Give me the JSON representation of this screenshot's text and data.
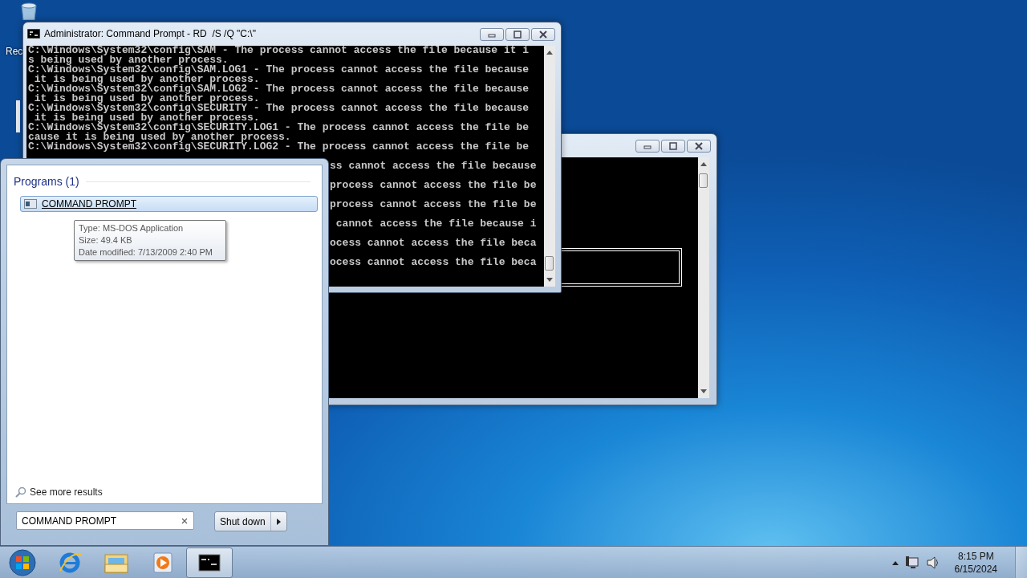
{
  "desktop": {
    "icons": [
      {
        "kind": "recycle_bin",
        "label": "Rec"
      }
    ]
  },
  "console_windows": [
    {
      "title": "Administrator: Command Prompt - RD  /S /Q \"C:\\\"",
      "lines": [
        "C:\\Windows\\System32\\config\\SAM - The process cannot access the file because it i",
        "s being used by another process.",
        "C:\\Windows\\System32\\config\\SAM.LOG1 - The process cannot access the file because",
        " it is being used by another process.",
        "C:\\Windows\\System32\\config\\SAM.LOG2 - The process cannot access the file because",
        " it is being used by another process.",
        "C:\\Windows\\System32\\config\\SECURITY - The process cannot access the file because",
        " it is being used by another process.",
        "C:\\Windows\\System32\\config\\SECURITY.LOG1 - The process cannot access the file be",
        "cause it is being used by another process.",
        "C:\\Windows\\System32\\config\\SECURITY.LOG2 - The process cannot access the file be"
      ],
      "partial_lines": [
        "ss cannot access the file because",
        "process cannot access the file be",
        "process cannot access the file be",
        " cannot access the file because i",
        "ocess cannot access the file beca",
        "ocess cannot access the file beca"
      ]
    },
    {
      "kind": "outlined_box"
    }
  ],
  "start_menu": {
    "section_title": "Programs (1)",
    "results": [
      {
        "label": "COMMAND PROMPT",
        "selected": true
      }
    ],
    "tooltip": [
      "Type: MS-DOS Application",
      "Size: 49.4 KB",
      "Date modified: 7/13/2009 2:40 PM"
    ],
    "see_more": "See more results",
    "search": {
      "value": "COMMAND PROMPT"
    },
    "shutdown": "Shut down"
  },
  "taskbar": {
    "apps": [
      {
        "kind": "ie",
        "active": false
      },
      {
        "kind": "explorer",
        "active": false
      },
      {
        "kind": "media",
        "active": false
      },
      {
        "kind": "cmd",
        "active": true
      }
    ],
    "clock": {
      "time": "8:15 PM",
      "date": "6/15/2024"
    }
  }
}
